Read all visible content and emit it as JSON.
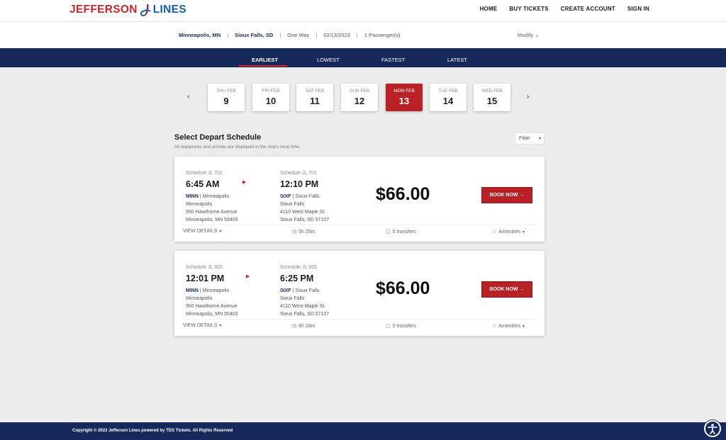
{
  "brand": {
    "left": "JEFFERSON",
    "right": "LINES"
  },
  "nav": [
    "HOME",
    "BUY TICKETS",
    "CREATE ACCOUNT",
    "SIGN IN"
  ],
  "trip": {
    "origin": "Minneapolis, MN",
    "destination": "Sioux Falls, SD",
    "type": "One Way",
    "date": "02/13/2023",
    "passengers": "1 Passenger(s)",
    "modify": "Modify"
  },
  "sort_tabs": [
    "EARLIEST",
    "LOWEST",
    "FASTEST",
    "LATEST"
  ],
  "dates": [
    {
      "day": "THU FEB",
      "num": "9"
    },
    {
      "day": "FRI FEB",
      "num": "10"
    },
    {
      "day": "SAT FEB",
      "num": "11"
    },
    {
      "day": "SUN FEB",
      "num": "12"
    },
    {
      "day": "MON FEB",
      "num": "13"
    },
    {
      "day": "TUE FEB",
      "num": "14"
    },
    {
      "day": "WED FEB",
      "num": "15"
    }
  ],
  "selected_date_index": 4,
  "schedule": {
    "title": "Select Depart Schedule",
    "subtitle": "All departures and arrivals are displayed in the stop's local time.",
    "filter": "Filter"
  },
  "results": [
    {
      "depart": {
        "schedule": "Schedule JL 701",
        "time": "6:45 AM",
        "code": "MINN",
        "name": "Minneapolis",
        "city": "Minneapolis",
        "street": "950 Hawthorne Avenue",
        "citystate": "Minneapolis, MN 55403"
      },
      "arrive": {
        "schedule": "Schedule JL 701",
        "time": "12:10 PM",
        "code": "SIXF",
        "name": "Sioux Falls",
        "city": "Sioux Falls",
        "street": "4110 West Maple St.",
        "citystate": "Sioux Falls, SD 57107"
      },
      "price": "$66.00",
      "book": "BOOK NOW",
      "view_details": "VIEW DETAILS",
      "duration": "5h 25m",
      "transfers": "0 transfers",
      "amenities": "Amenities"
    },
    {
      "depart": {
        "schedule": "Schedule JL 925",
        "time": "12:01 PM",
        "code": "MINN",
        "name": "Minneapolis",
        "city": "Minneapolis",
        "street": "950 Hawthorne Avenue",
        "citystate": "Minneapolis, MN 55403"
      },
      "arrive": {
        "schedule": "Schedule JL 925",
        "time": "6:25 PM",
        "code": "SIXF",
        "name": "Sioux Falls",
        "city": "Sioux Falls",
        "street": "4110 West Maple St.",
        "citystate": "Sioux Falls, SD 57107"
      },
      "price": "$66.00",
      "book": "BOOK NOW",
      "view_details": "VIEW DETAILS",
      "duration": "6h 24m",
      "transfers": "0 transfers",
      "amenities": "Amenities"
    }
  ],
  "footer": "Copyright © 2023 Jefferson Lines powered by TDS Tickets. All Rights Reserved",
  "colors": {
    "brand_red": "#b82125",
    "navy": "#16295a",
    "logo_blue": "#1a5ea8"
  }
}
